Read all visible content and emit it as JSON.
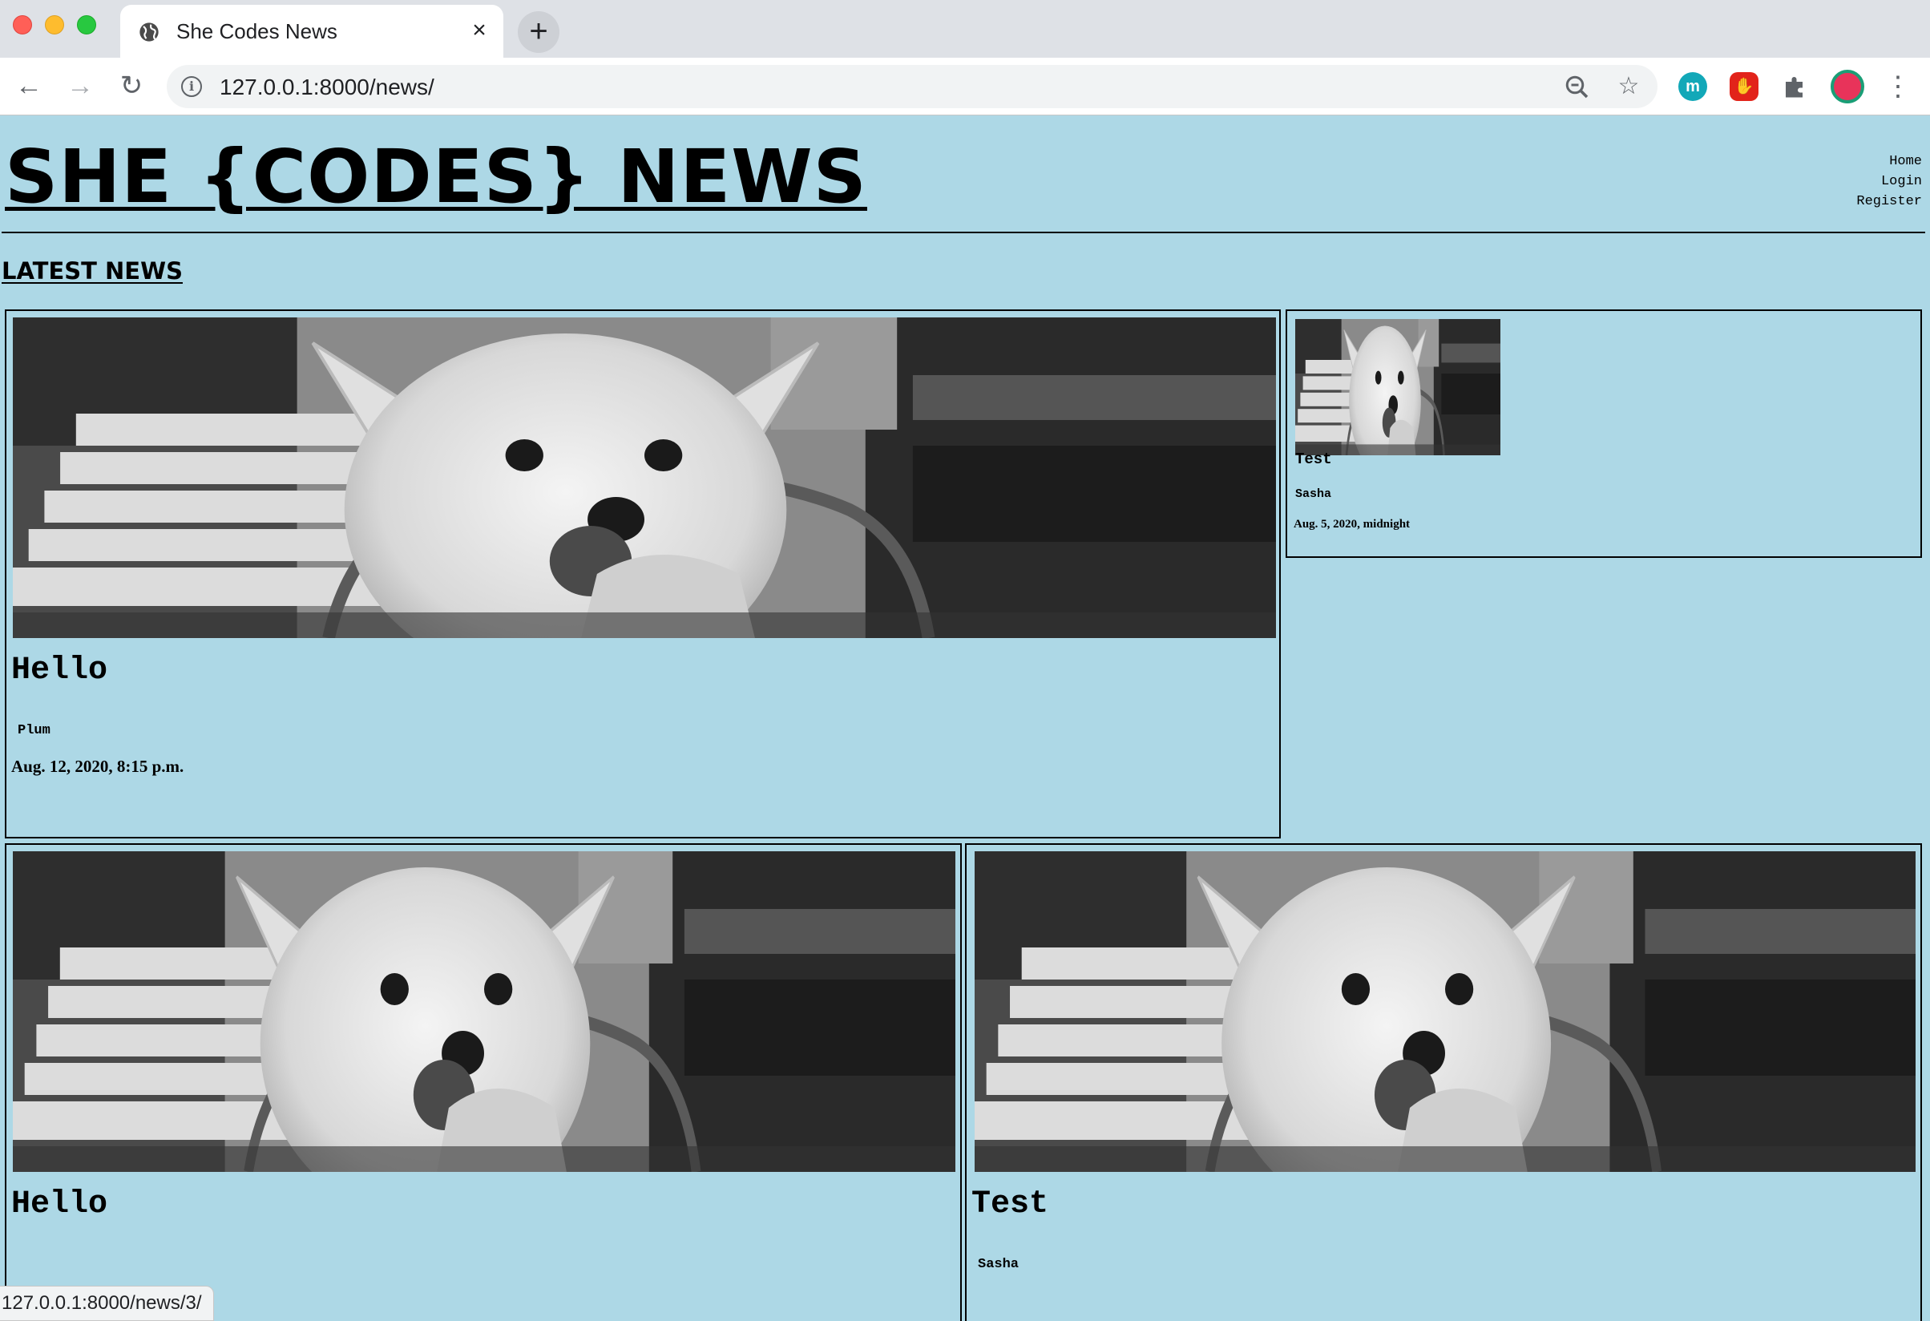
{
  "browser": {
    "tab_title": "She Codes News",
    "url": "127.0.0.1:8000/news/",
    "status_url": "127.0.0.1:8000/news/3/",
    "extensions": [
      "m"
    ]
  },
  "site": {
    "title": "SHE {CODES} NEWS",
    "nav": [
      "Home",
      "Login",
      "Register"
    ],
    "section_title": "LATEST NEWS"
  },
  "stories": [
    {
      "title": "Hello",
      "author": "Plum",
      "date": "Aug. 12, 2020, 8:15 p.m."
    },
    {
      "title": "Test",
      "author": "Sasha",
      "date": "Aug. 5, 2020, midnight"
    },
    {
      "title": "Hello",
      "author": "",
      "date": ""
    },
    {
      "title": "Test",
      "author": "Sasha",
      "date": ""
    }
  ],
  "colors": {
    "page_background": "#ADD8E6",
    "border": "#000000"
  }
}
